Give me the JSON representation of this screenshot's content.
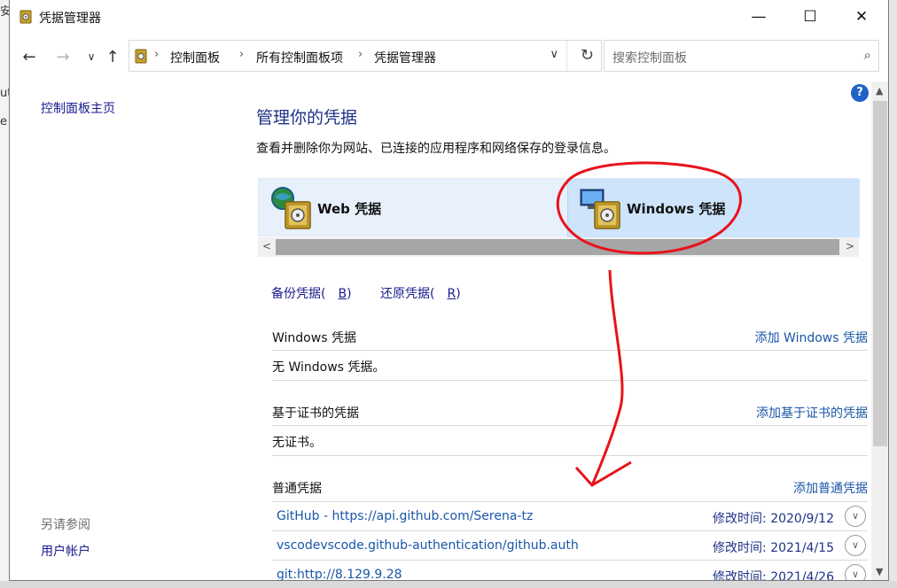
{
  "window": {
    "title": "凭据管理器",
    "minimize_symbol": "—",
    "maximize_symbol": "☐",
    "close_symbol": "✕"
  },
  "background": {
    "left_fragments": [
      "安",
      "ut",
      "e"
    ]
  },
  "nav": {
    "back": "←",
    "forward": "→",
    "recent": "∨",
    "up": "↑",
    "breadcrumb": [
      "控制面板",
      "所有控制面板项",
      "凭据管理器"
    ],
    "sep": "›",
    "dropdown": "∨",
    "refresh": "↻",
    "search_placeholder": "搜索控制面板",
    "search_icon_glyph": "⌕"
  },
  "sidebar": {
    "home_link": "控制面板主页",
    "see_also": "另请参阅",
    "user_accounts": "用户帐户"
  },
  "main": {
    "title": "管理你的凭据",
    "description": "查看并删除你为网站、已连接的应用程序和网络保存的登录信息。",
    "help": "?",
    "tabs": [
      {
        "label": "Web 凭据",
        "selected": false
      },
      {
        "label": "Windows 凭据",
        "selected": true
      }
    ],
    "hscroll_left": "<",
    "hscroll_right": ">",
    "backup_link_text": "备份凭据(",
    "backup_key": "B",
    "restore_link_text": "还原凭据(",
    "restore_key": "R",
    "link_close": ")",
    "sections": {
      "windows": {
        "title": "Windows 凭据",
        "add_link": "添加 Windows 凭据",
        "empty_text": "无 Windows 凭据。"
      },
      "certificate": {
        "title": "基于证书的凭据",
        "add_link": "添加基于证书的凭据",
        "empty_text": "无证书。"
      },
      "generic": {
        "title": "普通凭据",
        "add_link": "添加普通凭据",
        "items": [
          {
            "name": "GitHub - https://api.github.com/Serena-tz",
            "modified_label": "修改时间:",
            "modified": "2020/9/12"
          },
          {
            "name": "vscodevscode.github-authentication/github.auth",
            "modified_label": "修改时间:",
            "modified": "2021/4/15"
          },
          {
            "name": "git:http://8.129.9.28",
            "modified_label": "修改时间:",
            "modified": "2021/4/26"
          }
        ]
      }
    }
  },
  "colors": {
    "link_blue": "#1a56a8",
    "title_blue": "#1e3287",
    "tab_selected_bg": "#cde4fa",
    "annotation_red": "#e8131b"
  }
}
